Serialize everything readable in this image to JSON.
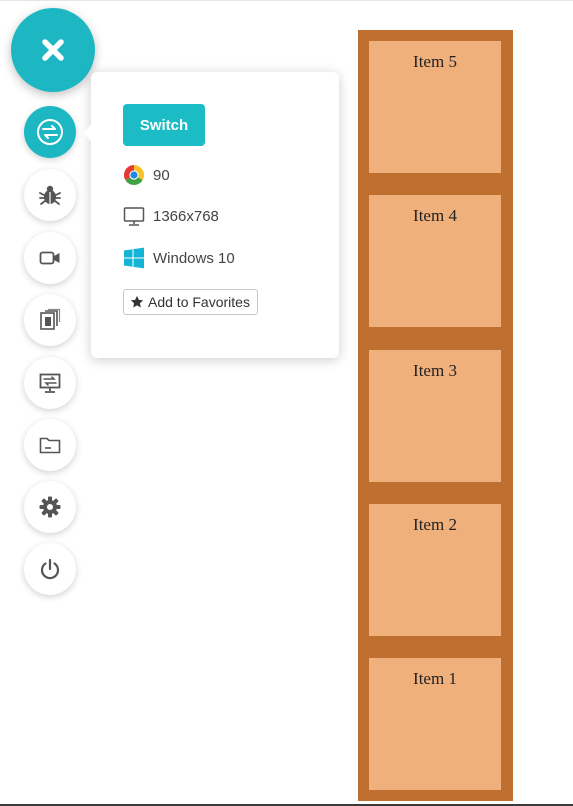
{
  "items": [
    "Item 5",
    "Item 4",
    "Item 3",
    "Item 2",
    "Item 1"
  ],
  "popover": {
    "switch_label": "Switch",
    "browser_version": "90",
    "resolution": "1366x768",
    "os": "Windows 10",
    "favorites_label": "Add to Favorites"
  },
  "menu": {
    "main": "close-icon",
    "buttons": [
      "switch-icon",
      "bug-icon",
      "video-icon",
      "gallery-icon",
      "remote-desktop-icon",
      "folder-icon",
      "gear-icon",
      "power-icon"
    ]
  },
  "colors": {
    "accent": "#1db7c4",
    "column": "#bf6f2f",
    "item": "#efb07c"
  }
}
